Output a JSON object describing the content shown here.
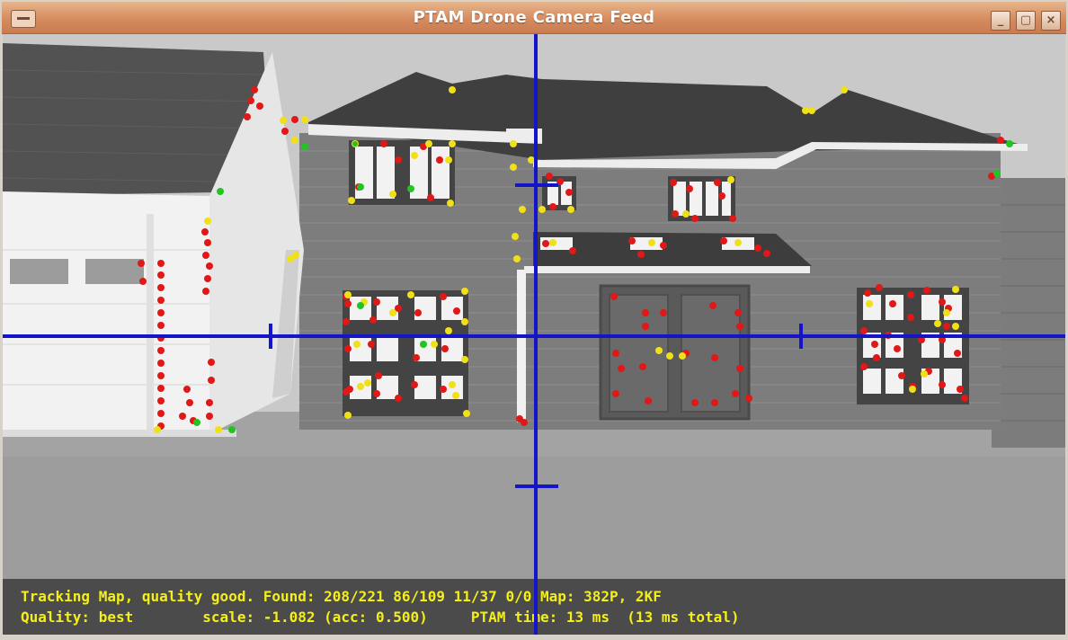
{
  "window": {
    "title": "PTAM Drone Camera Feed",
    "controls": {
      "minimize": "_",
      "maximize": "▢",
      "close": "×"
    }
  },
  "status": {
    "line1": "Tracking Map, quality good. Found: 208/221 86/109 11/37 0/0 Map: 382P, 2KF",
    "line2": "Quality: best        scale: -1.082 (acc: 0.500)     PTAM time: 13 ms  (13 ms total)"
  },
  "colors": {
    "crosshair": "#1414c8",
    "feature_red": "#e01818",
    "feature_yellow": "#f0e018",
    "feature_green": "#22c422",
    "status_text": "#f4ef19"
  }
}
